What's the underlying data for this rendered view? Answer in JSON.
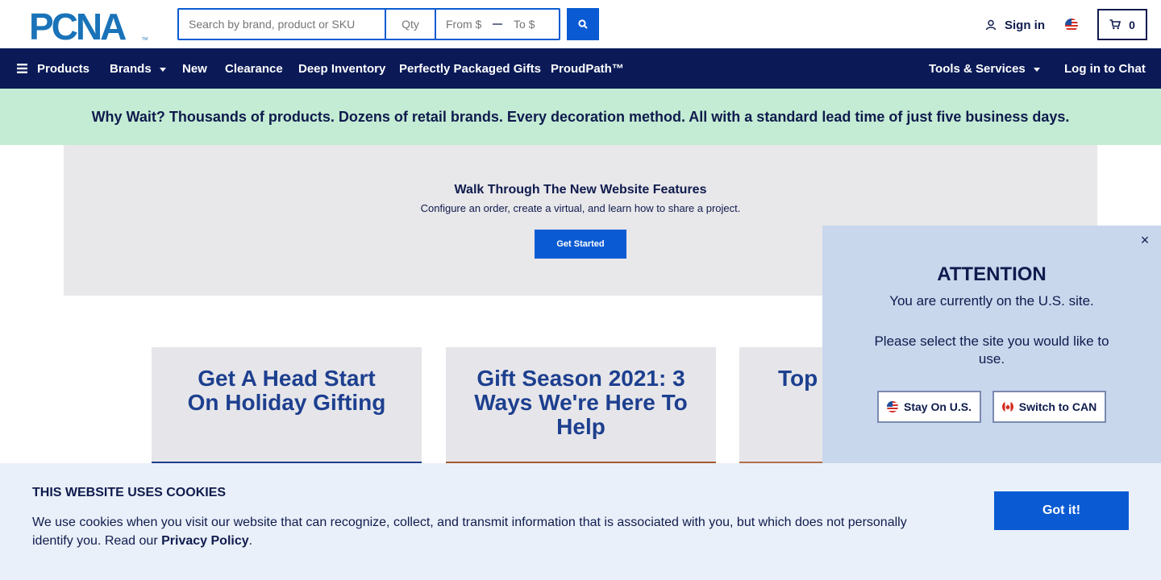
{
  "header": {
    "logo_text": "PCNA",
    "search": {
      "placeholder": "Search by brand, product or SKU",
      "value": ""
    },
    "qty": {
      "placeholder": "Qty"
    },
    "price_from": {
      "placeholder": "From $"
    },
    "price_to": {
      "placeholder": "To $"
    },
    "signin_label": "Sign in",
    "cart_count": "0"
  },
  "nav": {
    "products": "Products",
    "brands": "Brands",
    "new": "New",
    "clearance": "Clearance",
    "deep_inventory": "Deep Inventory",
    "packaged_gifts": "Perfectly Packaged Gifts",
    "proudpath": "ProudPath™",
    "tools": "Tools & Services",
    "chat": "Log in to Chat"
  },
  "promo": {
    "text": "Why Wait? Thousands of products. Dozens of retail brands. Every decoration method. All with a standard lead time of just five business days."
  },
  "hero": {
    "title": "Walk Through The New Website Features",
    "subtitle": "Configure an order, create a virtual, and learn how to share a project.",
    "button": "Get Started"
  },
  "cards": [
    {
      "title": "Get A Head Start On Holiday Gifting"
    },
    {
      "title": "Gift Season 2021: 3 Ways We're Here To Help"
    },
    {
      "title": "Top For"
    }
  ],
  "modal": {
    "title": "ATTENTION",
    "line1": "You are currently on the U.S. site.",
    "line2": "Please select the site you would like to use.",
    "stay_button": "Stay On U.S.",
    "switch_button": "Switch to CAN",
    "close_symbol": "×"
  },
  "cookie": {
    "title": "THIS WEBSITE USES COOKIES",
    "text": "We use cookies when you visit our website that can recognize, collect, and transmit information that is associated with you, but which does not personally identify you. Read our",
    "link": "Privacy Policy",
    "suffix": ".",
    "button": "Got it!"
  },
  "colors": {
    "navy": "#0b1a57",
    "accent_blue": "#0a5bd3",
    "promo_green": "#c4ecd4",
    "hero_gray": "#e8e7ea",
    "modal_blue": "#c8d7ec",
    "cookie_bg": "#eaf0f9",
    "card_title": "#1d3f8f"
  },
  "icons": [
    "search-icon",
    "user-icon",
    "us-flag-icon",
    "cart-icon",
    "menu-icon",
    "chevron-down-icon",
    "close-icon",
    "canada-flag-icon"
  ]
}
